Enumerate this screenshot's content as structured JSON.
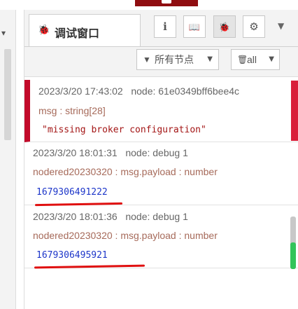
{
  "sidebar": {
    "tab_title": "调试窗口",
    "tabs": [
      {
        "name": "info",
        "icon": "info-icon",
        "glyph": "i"
      },
      {
        "name": "help",
        "icon": "book-icon",
        "glyph": "📖"
      },
      {
        "name": "debug",
        "icon": "bug-icon",
        "glyph": "🐞"
      },
      {
        "name": "config",
        "icon": "gear-icon",
        "glyph": "⚙"
      }
    ]
  },
  "toolbar": {
    "filter_label": "所有节点",
    "clear_label": "all"
  },
  "messages": [
    {
      "timestamp": "2023/3/20 17:43:02",
      "node": "node: 61e0349bff6bee4c",
      "path": "msg : string[28]",
      "value": "\"missing broker configuration\"",
      "type": "string",
      "error": true
    },
    {
      "timestamp": "2023/3/20 18:01:31",
      "node": "node: debug 1",
      "path": "nodered20230320 : msg.payload : number",
      "value": "1679306491222",
      "type": "number",
      "error": false
    },
    {
      "timestamp": "2023/3/20 18:01:36",
      "node": "node: debug 1",
      "path": "nodered20230320 : msg.payload : number",
      "value": "1679306495921",
      "type": "number",
      "error": false
    }
  ],
  "colors": {
    "error_accent": "#c20a2a",
    "number_value": "#1d36c9",
    "string_value": "#a31515",
    "annotation": "#e01010",
    "scroll_indicator": "#33c45a"
  }
}
